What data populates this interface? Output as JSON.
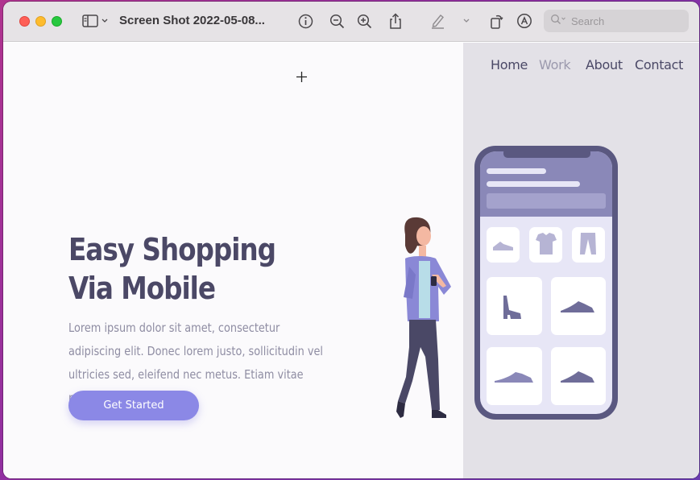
{
  "window": {
    "title": "Screen Shot 2022-05-08...",
    "search_placeholder": "Search"
  },
  "toolbar": {
    "icons": [
      "sidebar-toggle-icon",
      "chevron-down-icon",
      "info-icon",
      "zoom-out-icon",
      "zoom-in-icon",
      "share-icon",
      "highlight-pen-icon",
      "chevron-down-icon",
      "rotate-icon",
      "markup-icon",
      "search-icon"
    ]
  },
  "site": {
    "nav": {
      "home": "Home",
      "work": "Work",
      "about": "About",
      "contact": "Contact"
    },
    "hero": {
      "line1": "Easy Shopping",
      "line2": "Via Mobile",
      "body": "Lorem ipsum dolor sit amet, consectetur  adipiscing elit. Donec lorem justo, sollicitudin vel ultricies sed, eleifend nec metus. Etiam vitae pellentesque dolor.",
      "cta": "Get Started"
    },
    "colors": {
      "accent": "#8b88e6",
      "heading": "#4b4866",
      "panel": "#e3e1e7"
    }
  }
}
